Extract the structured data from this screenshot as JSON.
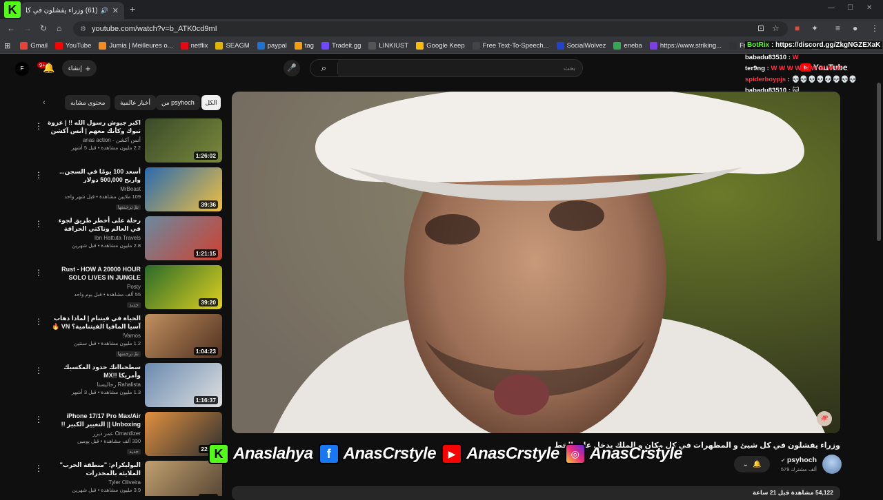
{
  "browser": {
    "tab_title": "(61) وزراء يفشلون في كل ش",
    "new_tab": "+",
    "url": "youtube.com/watch?v=b_ATK0cd9mI",
    "counter": "60",
    "bookmarks": [
      {
        "label": "Gmail",
        "color": "#ea4335"
      },
      {
        "label": "YouTube",
        "color": "#ff0000"
      },
      {
        "label": "Jumia | Meilleures o...",
        "color": "#f68b1e"
      },
      {
        "label": "netflix",
        "color": "#e50914"
      },
      {
        "label": "SEAGM",
        "color": "#e0b500"
      },
      {
        "label": "paypal",
        "color": "#1b73d3"
      },
      {
        "label": "tag",
        "color": "#f59e0b"
      },
      {
        "label": "Tradeit.gg",
        "color": "#6d4aff"
      },
      {
        "label": "LINKIUST",
        "color": "#555555"
      },
      {
        "label": "Google Keep",
        "color": "#fbbc04"
      },
      {
        "label": "Free Text-To-Speech...",
        "color": "#444444"
      },
      {
        "label": "SocialWolvez",
        "color": "#2442c9"
      },
      {
        "label": "eneba",
        "color": "#34a853"
      },
      {
        "label": "https://www.striking...",
        "color": "#7b3fe4"
      },
      {
        "label": "Free Cursor Downlo...",
        "color": "#333333"
      },
      {
        "label": "PDF",
        "color": "#d93025"
      }
    ]
  },
  "youtube": {
    "notifications": "9+",
    "create_label": "إنشاء",
    "search_placeholder": "بحث",
    "logo_text": "YouTube"
  },
  "chat": {
    "bot_name": "BotRix",
    "bot_text": ": https://discord.gg/ZkgNGZEXaK",
    "lines": [
      {
        "user": "babadu83510",
        "msg": "W"
      },
      {
        "user": "ter9ng",
        "msg": "W W W W W W W W W"
      },
      {
        "user": "spiderboypjs",
        "msg": "💀💀💀💀💀💀💀💀"
      },
      {
        "user": "babadu83510",
        "msg": ""
      }
    ]
  },
  "chips": [
    {
      "label": "الكل",
      "active": true
    },
    {
      "label": "من psyhoch",
      "active": false
    },
    {
      "label": "أخبار عالمية",
      "active": false
    },
    {
      "label": "محتوى مشابه",
      "active": false
    }
  ],
  "recommendations": [
    {
      "title": "اكبر جيوش رسول الله !! | غزوة تبوك وكأنك معهم | أنس آكشن",
      "channel": "أنس آكشن - anas action",
      "meta": "2.2 مليون مشاهدة • قبل 5 أشهر",
      "duration": "1:26:02",
      "badge": ""
    },
    {
      "title": "أسعد 100 يومًا في السجن... واربح 500,000 دولار",
      "channel": "MrBeast",
      "meta": "109 ملايين مشاهدة • قبل شهر واحد",
      "duration": "39:36",
      "badge": "تمّ ترجمتها"
    },
    {
      "title": "رحلة على أخطر طريق لجوء في العالم وتاكتي الحرافة",
      "channel": "Ibn Hattuta Travels",
      "meta": "2.8 مليون مشاهدة • قبل شهرين",
      "duration": "1:21:15",
      "badge": ""
    },
    {
      "title": "Rust - HOW A 20000 HOUR SOLO LIVES IN JUNGLE",
      "channel": "Posty",
      "meta": "55 ألف مشاهدة • قبل يوم واحد",
      "duration": "39:20",
      "badge": "جديد"
    },
    {
      "title": "الحياة في فيتنام | لماذا ذهاب آسيا المافيا الفيتنامية؟ VN 🔥",
      "channel": "Vamos!",
      "meta": "1.2 مليون مشاهدة • قبل سنتين",
      "duration": "1:04:23",
      "badge": "تمّ ترجمتها"
    },
    {
      "title": "سطحنااتك حدود المكسيك وأمريكا !!MX",
      "channel": "Rahalista رحاليستا",
      "meta": "1.3 مليون مشاهدة • قبل 3 أشهر",
      "duration": "1:16:37",
      "badge": ""
    },
    {
      "title": "iPhone 17/17 Pro Max/Air Unboxing || التغيير الكبير !!",
      "channel": "Omardizer عمر ديزر",
      "meta": "330 ألف مشاهدة • قبل يومين",
      "duration": "22:06",
      "badge": "جديد"
    },
    {
      "title": "البوليكرام: \"منطقة الحرب\" الملايئة بالمخدرات",
      "channel": "Tyler Oliveira",
      "meta": "3.9 مليون مشاهدة • قبل شهرين",
      "duration": "21:25",
      "badge": "تمّ ترجمتها"
    }
  ],
  "video": {
    "title": "وزراء يفشلون في كل شيئ و المظهرات في كل مكان و الملك يدخل على الخط",
    "channel": "psyhoch",
    "subs": "579 ألف مشترك",
    "views_line": "54,122 مشاهدة قبل 21 ساعة"
  },
  "social": {
    "kick": "Anaslahya",
    "facebook": "AnasCrstyle",
    "youtube": "AnasCrstyle",
    "instagram": "AnasCrstyle"
  },
  "colors": {
    "kick_green": "#53fc18",
    "yt_red": "#ff0000",
    "fb_blue": "#1877f2"
  }
}
